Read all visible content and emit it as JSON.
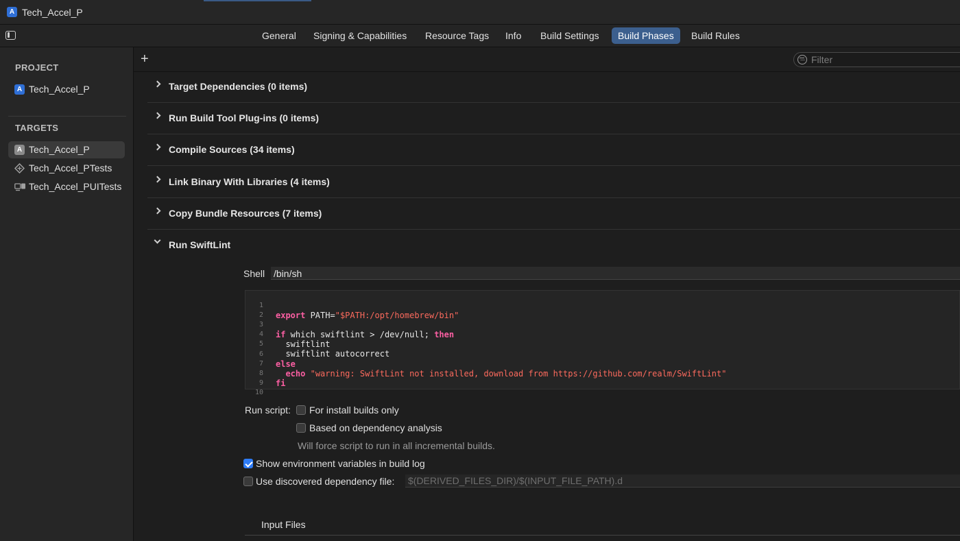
{
  "window": {
    "title": "Tech_Accel_P"
  },
  "tabs": [
    "General",
    "Signing & Capabilities",
    "Resource Tags",
    "Info",
    "Build Settings",
    "Build Phases",
    "Build Rules"
  ],
  "active_tab": "Build Phases",
  "sidebar": {
    "project_heading": "PROJECT",
    "project_item": "Tech_Accel_P",
    "targets_heading": "TARGETS",
    "targets": [
      "Tech_Accel_P",
      "Tech_Accel_PTests",
      "Tech_Accel_PUITests"
    ],
    "selected_target": "Tech_Accel_P"
  },
  "toolbar": {
    "add": "+",
    "filter_placeholder": "Filter"
  },
  "phases": [
    "Target Dependencies (0 items)",
    "Run Build Tool Plug-ins (0 items)",
    "Compile Sources (34 items)",
    "Link Binary With Libraries (4 items)",
    "Copy Bundle Resources (7 items)",
    "Run SwiftLint"
  ],
  "script": {
    "shell_label": "Shell",
    "shell_value": "/bin/sh",
    "line_numbers": [
      "1",
      "2",
      "3",
      "4",
      "5",
      "6",
      "7",
      "8",
      "9",
      "10"
    ],
    "code": {
      "l1_kw": "export",
      "l1_plain": " PATH=",
      "l1_str": "\"$PATH:/opt/homebrew/bin\"",
      "l3_kw1": "if",
      "l3_plain": " which swiftlint > /dev/null; ",
      "l3_kw2": "then",
      "l4": "  swiftlint",
      "l5": "  swiftlint autocorrect",
      "l6_kw": "else",
      "l7_indent": "  ",
      "l7_kw": "echo",
      "l7_plain": " ",
      "l7_str": "\"warning: SwiftLint not installed, download from https://github.com/realm/SwiftLint\"",
      "l8_kw": "fi"
    },
    "run_script_label": "Run script:",
    "install_builds_only": {
      "label": "For install builds only",
      "checked": false
    },
    "dependency_analysis": {
      "label": "Based on dependency analysis",
      "checked": false
    },
    "dependency_hint": "Will force script to run in all incremental builds.",
    "show_env_vars": {
      "label": "Show environment variables in build log",
      "checked": true
    },
    "use_dep_file": {
      "label": "Use discovered dependency file:",
      "checked": false
    },
    "dep_file_placeholder": "$(DERIVED_FILES_DIR)/$(INPUT_FILE_PATH).d",
    "input_files_heading": "Input Files"
  },
  "colors": {
    "accent": "#3c5f8e",
    "checkbox_on": "#2e7cf6",
    "keyword": "#fc5fa3",
    "string": "#fc6a5d"
  }
}
